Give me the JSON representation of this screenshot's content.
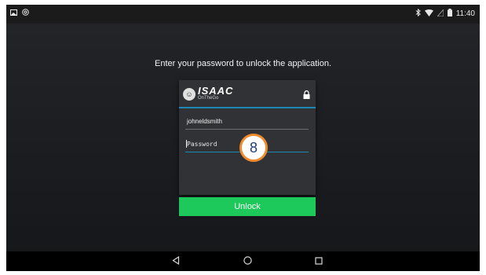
{
  "status_bar": {
    "left_icons": [
      "picture-icon",
      "at-sign-icon"
    ],
    "right_icons": [
      "bluetooth-icon",
      "wifi-icon",
      "signal-icon",
      "battery-icon"
    ],
    "time": "11:40"
  },
  "prompt": "Enter your password to unlock the application.",
  "dialog": {
    "logo_title": "ISAAC",
    "logo_subtitle": "OnTheGo",
    "username": "johneldsmith",
    "password_placeholder": "Password",
    "unlock_label": "Unlock",
    "accent_color": "#1e88b5",
    "button_color": "#1ec95c"
  },
  "step_badge": "8",
  "nav": {
    "items": [
      "back-icon",
      "home-icon",
      "recents-icon"
    ]
  }
}
